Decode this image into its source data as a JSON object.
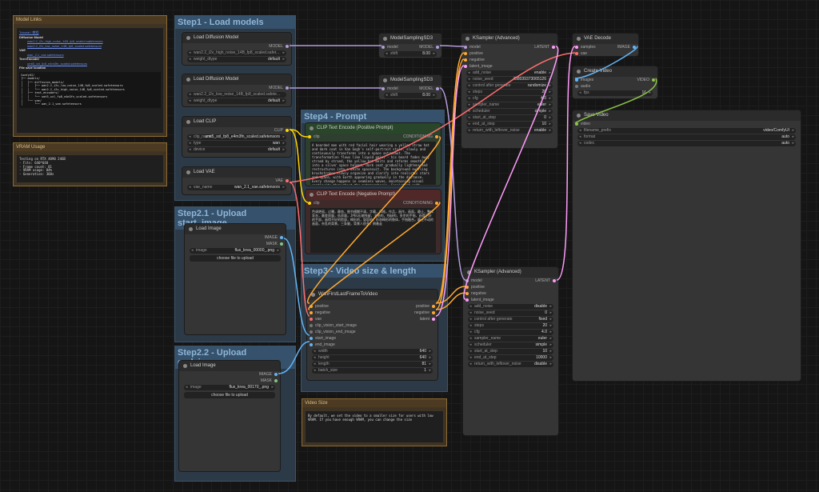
{
  "model_links": {
    "title": "Model Links",
    "header_link": "Tutorial / 教程",
    "diffusion_label": "Diffusion Model",
    "diffusion_links": [
      "wan2.2_i2v_high_noise_14B_fp8_scaled.safetensors",
      "wan2.2_i2v_low_noise_14B_fp8_scaled.safetensors"
    ],
    "vae_label": "VAE",
    "vae_links": [
      "wan_2.1_vae.safetensors"
    ],
    "te_label": "Text Encoder",
    "te_links": [
      "umt5_xxl_fp8_e4m3fn_scaled.safetensors"
    ],
    "file_label": "File save location",
    "tree": [
      "ComfyUI/",
      "├── models/",
      "│   ├── diffusion_models/",
      "│   │   ├── wan2.2_i2v_low_noise_14B_fp8_scaled.safetensors",
      "│   │   └── wan2.2_i2v_high_noise_14B_fp8_scaled.safetensors",
      "│   ├── text_encoders/",
      "│   │   └── umt5_xxl_fp8_e4m3fn_scaled.safetensors",
      "│   └── vae/",
      "│       └── wan_2.1_vae.safetensors"
    ]
  },
  "vram": {
    "title": "VRAM Usage",
    "lines": [
      "Testing on RTX 4090 24GB",
      "- Fits: 640*640",
      "- Frame count: 81",
      "- VRAM usage: 84%",
      "- Generation: 360s"
    ]
  },
  "groups": {
    "step1": "Step1 - Load models",
    "step21": "Step2.1 - Upload start_image",
    "step22": "Step2.2 - Upload end_image",
    "step3": "Step3 - Video size & length",
    "step4": "Step4 - Prompt"
  },
  "load_diff1": {
    "title": "Load Diffusion Model",
    "out": "MODEL",
    "unet_name": "wan2.2_i2v_high_noise_14B_fp8_scaled.safet...",
    "weight_label": "weight_dtype",
    "weight_dtype": "default"
  },
  "load_diff2": {
    "title": "Load Diffusion Model",
    "out": "MODEL",
    "unet_name": "wan2.2_i2v_low_noise_14B_fp8_scaled.safete...",
    "weight_label": "weight_dtype",
    "weight_dtype": "default"
  },
  "load_clip": {
    "title": "Load CLIP",
    "out": "CLIP",
    "clip_label": "clip_name",
    "clip_name": "umt5_xxl_fp8_e4m3fn_scaled.safetensors",
    "type_label": "type",
    "type": "wan",
    "device_label": "device",
    "device": "default"
  },
  "load_vae": {
    "title": "Load VAE",
    "out": "VAE",
    "vae_label": "vae_name",
    "vae_name": "wan_2.1_vae.safetensors"
  },
  "load_image1": {
    "title": "Load Image",
    "out1": "IMAGE",
    "out2": "MASK",
    "image_label": "image",
    "image": "flux_krea_00000_.png",
    "upload": "choose file to upload"
  },
  "load_image2": {
    "title": "Load Image",
    "out1": "IMAGE",
    "out2": "MASK",
    "image_label": "image",
    "image": "flux_krea_00170_.png",
    "upload": "choose file to upload"
  },
  "msd1": {
    "title": "ModelSamplingSD3",
    "in": "model",
    "out": "MODEL",
    "shift_label": "shift",
    "shift": "8.00"
  },
  "msd2": {
    "title": "ModelSamplingSD3",
    "in": "model",
    "out": "MODEL",
    "shift_label": "shift",
    "shift": "8.00"
  },
  "clip_pos": {
    "title": "CLIP Text Encode (Positive Prompt)",
    "in": "clip",
    "out": "CONDITIONING",
    "text": "A bearded man with red facial hair wearing a yellow straw hat and dark coat in Van Gogh's self-portrait style, slowly and continuously transforms into a space astronaut. The transformation flows like liquid paint - his beard fades away strand by strand, the yellow hat melts and reforms smoothly into a silver space helmet, dark coat gradually lightens and restructures into a white spacesuit. The background swirling brushstrokes slowly organize and clarify into realistic stars and space, with Earth appearing gradually in the distance. Every change happens in seamless waves, maintaining visual continuity throughout the metamorphosis.\n\nConsistent soft lighting throughout, medium close-up maintaining same framing, central composition stays fixed, gentle color temperature shift from warm to cool, gradual contrast increase, smooth style transition from painterly to photorealistic. Static camera with subtle slow zoom, emphasizing the flowing transformation process without abrupt changes."
  },
  "clip_neg": {
    "title": "CLIP Text Encode (Negative Prompt)",
    "in": "clip",
    "out": "CONDITIONING",
    "text": "色调艳丽，过曝，静态，细节模糊不清，字幕，风格，作品，画作，画面，静止，整体发灰，最差质量，低质量，JPEG压缩残留，丑陋的，残缺的，多余的手指，画得不好的手部，画得不好的脸部，畸形的，毁容的，形态畸形的肢体，手指融合，静止不动的画面，杂乱的背景，三条腿，背景人很多，倒着走"
  },
  "wan_node": {
    "title": "WanFirstLastFrameToVideo",
    "inputs": [
      "positive",
      "negative",
      "vae",
      "clip_vision_start_image",
      "clip_vision_end_image",
      "start_image",
      "end_image"
    ],
    "outputs": [
      "positive",
      "negative",
      "latent"
    ],
    "w_width_label": "width",
    "width": "640",
    "w_height_label": "height",
    "height": "640",
    "w_length_label": "length",
    "length": "81",
    "w_batch_label": "batch_size",
    "batch": "1"
  },
  "video_size": {
    "title": "Video Size",
    "text": "By default, we set the video to a smaller size for users with low VRAM. If you have enough VRAM, you can change the size"
  },
  "ks1": {
    "title": "KSampler (Advanced)",
    "inputs": [
      "model",
      "positive",
      "negative",
      "latent_image"
    ],
    "out": "LATENT",
    "widgets": [
      [
        "add_noise",
        "enable"
      ],
      [
        "noise_seed",
        "458039373065126"
      ],
      [
        "control after generate",
        "randomize"
      ],
      [
        "steps",
        "20"
      ],
      [
        "cfg",
        "4.0"
      ],
      [
        "sampler_name",
        "euler"
      ],
      [
        "scheduler",
        "simple"
      ],
      [
        "start_at_step",
        "0"
      ],
      [
        "end_at_step",
        "10"
      ],
      [
        "return_with_leftover_noise",
        "enable"
      ]
    ]
  },
  "ks2": {
    "title": "KSampler (Advanced)",
    "inputs": [
      "model",
      "positive",
      "negative",
      "latent_image"
    ],
    "out": "LATENT",
    "widgets": [
      [
        "add_noise",
        "disable"
      ],
      [
        "noise_seed",
        "0"
      ],
      [
        "control after generate",
        "fixed"
      ],
      [
        "steps",
        "20"
      ],
      [
        "cfg",
        "4.0"
      ],
      [
        "sampler_name",
        "euler"
      ],
      [
        "scheduler",
        "simple"
      ],
      [
        "start_at_step",
        "10"
      ],
      [
        "end_at_step",
        "10000"
      ],
      [
        "return_with_leftover_noise",
        "disable"
      ]
    ]
  },
  "vae_decode": {
    "title": "VAE Decode",
    "in1": "samples",
    "in2": "vae",
    "out": "IMAGE"
  },
  "create_video": {
    "title": "Create Video",
    "in1": "images",
    "in2": "audio",
    "out": "VIDEO",
    "fps_label": "fps",
    "fps": "16"
  },
  "save_video": {
    "title": "Save Video",
    "in": "video",
    "w1": "filename_prefix",
    "v1": "video/ComfyUI",
    "w2": "format",
    "v2": "auto",
    "w3": "codec",
    "v3": "auto"
  },
  "colors": {
    "model": "#b39ddb",
    "clip": "#ffd500",
    "vae": "#ff6e6e",
    "cond": "#ffa931",
    "latent": "#ff9cf9",
    "image": "#64b5f6"
  }
}
